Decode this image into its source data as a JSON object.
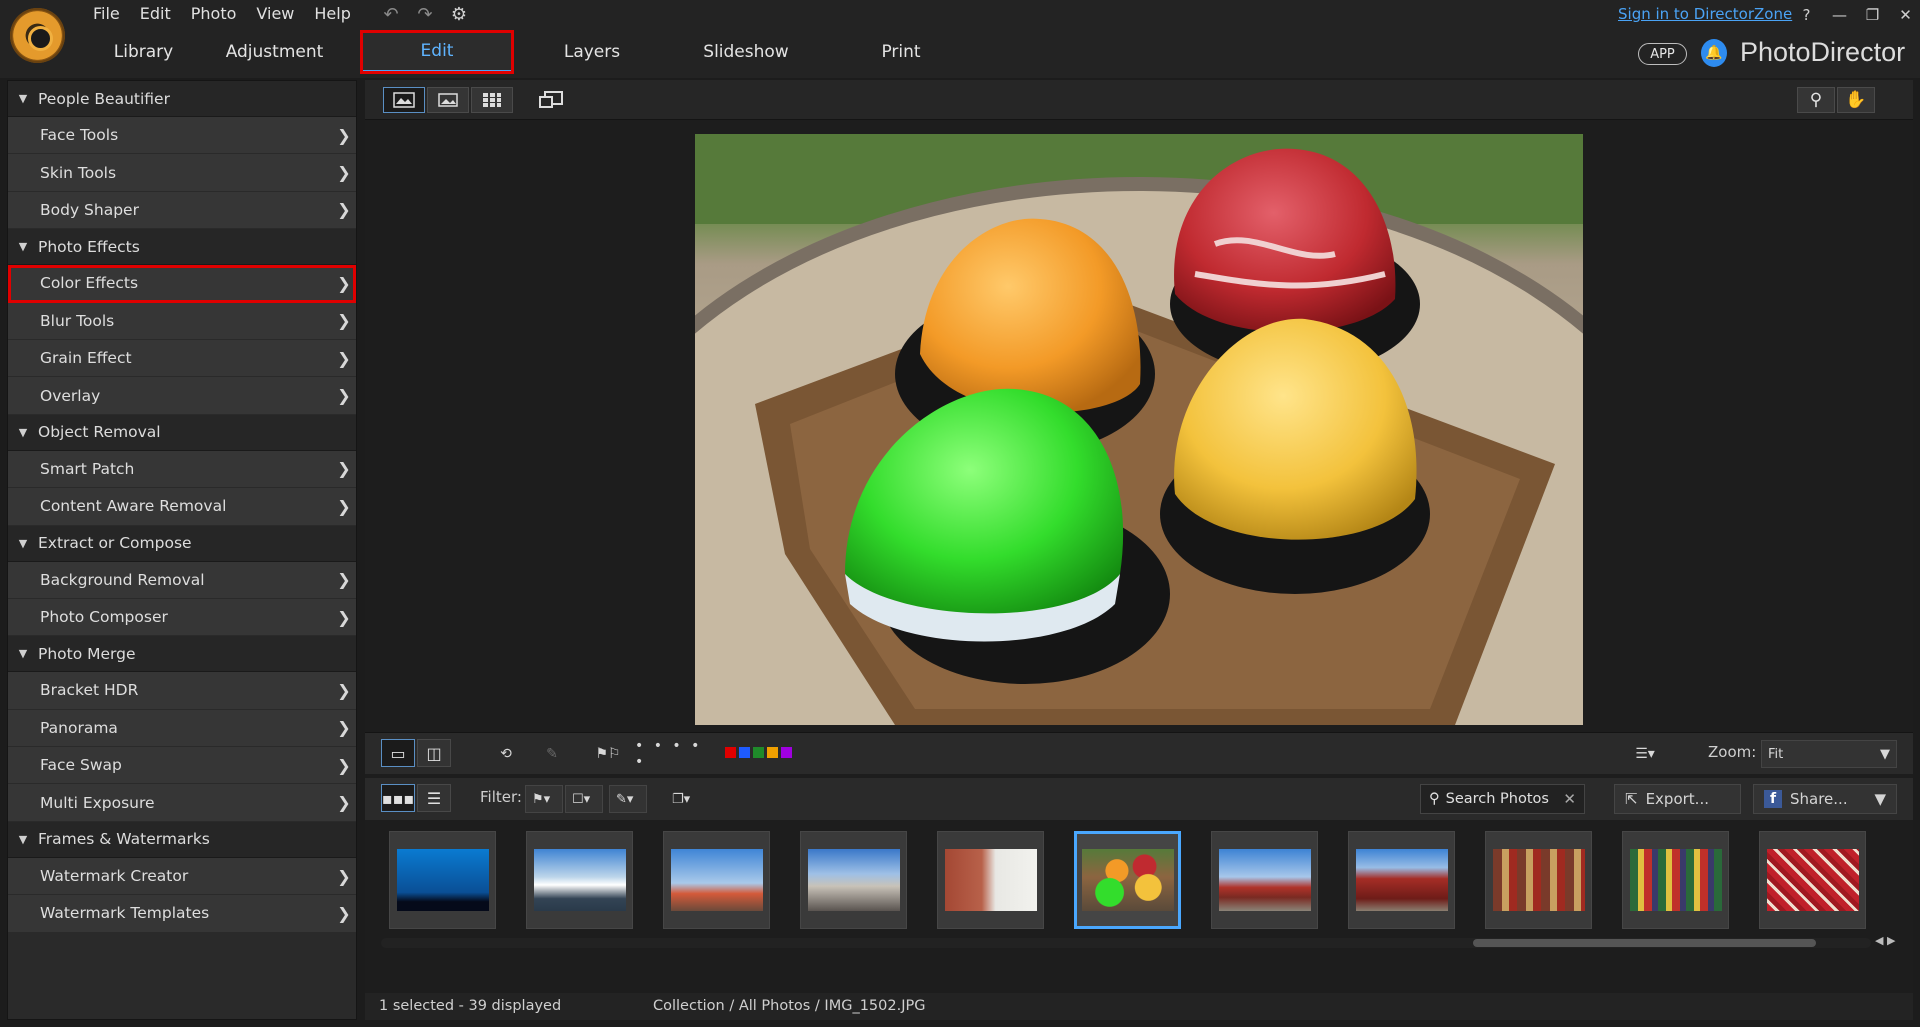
{
  "menu": [
    "File",
    "Edit",
    "Photo",
    "View",
    "Help"
  ],
  "tabs": [
    "Library",
    "Adjustment",
    "Edit",
    "Layers",
    "Slideshow",
    "Print"
  ],
  "active_tab": "Edit",
  "signin_link": "Sign in to DirectorZone",
  "window_controls": [
    "?",
    "—",
    "❐",
    "✕"
  ],
  "app_badge": "APP",
  "brand": "PhotoDirector",
  "sidebar": {
    "sections": [
      {
        "title": "People Beautifier",
        "items": [
          "Face Tools",
          "Skin Tools",
          "Body Shaper"
        ]
      },
      {
        "title": "Photo Effects",
        "items": [
          "Color Effects",
          "Blur Tools",
          "Grain Effect",
          "Overlay"
        ]
      },
      {
        "title": "Object Removal",
        "items": [
          "Smart Patch",
          "Content Aware Removal"
        ]
      },
      {
        "title": "Extract or Compose",
        "items": [
          "Background Removal",
          "Photo Composer"
        ]
      },
      {
        "title": "Photo Merge",
        "items": [
          "Bracket HDR",
          "Panorama",
          "Face Swap",
          "Multi Exposure"
        ]
      },
      {
        "title": "Frames & Watermarks",
        "items": [
          "Watermark Creator",
          "Watermark Templates"
        ]
      }
    ],
    "highlighted_item": "Color Effects"
  },
  "toolbar": {
    "filter_label": "Filter:",
    "zoom_label": "Zoom:",
    "zoom_value": "Fit",
    "search_placeholder": "Search Photos",
    "export_label": "Export...",
    "share_label": "Share...",
    "rating_dots": "• • • • •",
    "label_colors": [
      "#e00000",
      "#1e5bff",
      "#1f8a2a",
      "#f0a000",
      "#a000e0"
    ]
  },
  "status": {
    "selection": "1 selected - 39 displayed",
    "path": "Collection / All Photos / IMG_1502.JPG"
  }
}
